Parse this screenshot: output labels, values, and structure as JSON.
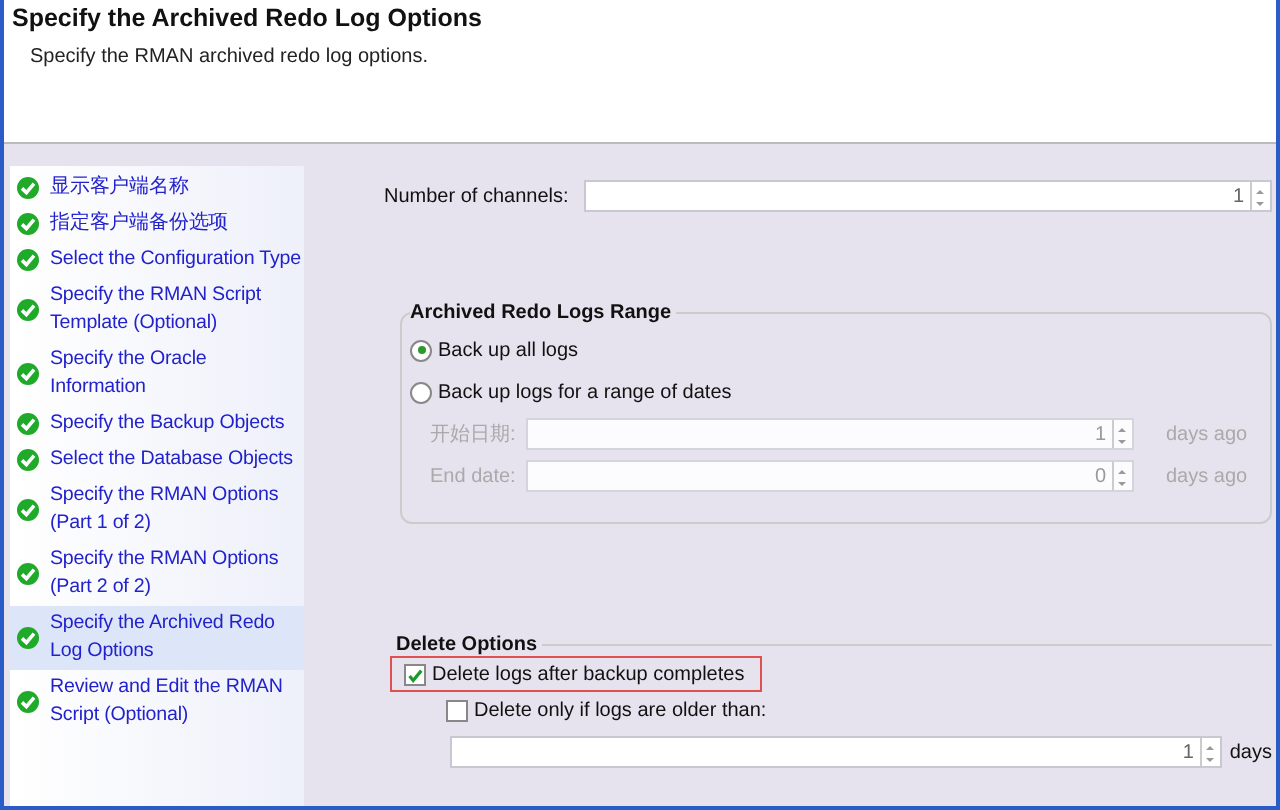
{
  "header": {
    "title": "Specify the Archived Redo Log Options",
    "description": "Specify the RMAN archived redo log options."
  },
  "steps": [
    {
      "label": "显示客户端名称",
      "done": true,
      "selected": false
    },
    {
      "label": "指定客户端备份选项",
      "done": true,
      "selected": false
    },
    {
      "label": "Select the Configuration Type",
      "done": true,
      "selected": false
    },
    {
      "label": "Specify the RMAN Script Template (Optional)",
      "done": true,
      "selected": false
    },
    {
      "label": "Specify the Oracle Information",
      "done": true,
      "selected": false
    },
    {
      "label": "Specify the Backup Objects",
      "done": true,
      "selected": false
    },
    {
      "label": "Select the Database Objects",
      "done": true,
      "selected": false
    },
    {
      "label": "Specify the RMAN Options (Part 1 of 2)",
      "done": true,
      "selected": false
    },
    {
      "label": "Specify the RMAN Options (Part 2 of 2)",
      "done": true,
      "selected": false
    },
    {
      "label": "Specify the Archived Redo Log Options",
      "done": true,
      "selected": true
    },
    {
      "label": "Review and Edit the RMAN Script (Optional)",
      "done": true,
      "selected": false
    }
  ],
  "channels": {
    "label": "Number of channels:",
    "value": "1"
  },
  "range": {
    "title": "Archived Redo Logs Range",
    "options": [
      {
        "label": "Back up all logs",
        "selected": true
      },
      {
        "label": "Back up logs for a range of dates",
        "selected": false
      }
    ],
    "fields": [
      {
        "label": "开始日期:",
        "value": "1",
        "unit": "days ago",
        "disabled": true
      },
      {
        "label": "End date:",
        "value": "0",
        "unit": "days ago",
        "disabled": true
      }
    ]
  },
  "delete": {
    "title": "Delete Options",
    "after_backup": {
      "label": "Delete logs after backup completes",
      "checked": true,
      "highlighted": true
    },
    "only_older": {
      "label": "Delete only if logs are older than:",
      "checked": false
    },
    "age": {
      "value": "1",
      "unit": "days"
    }
  }
}
